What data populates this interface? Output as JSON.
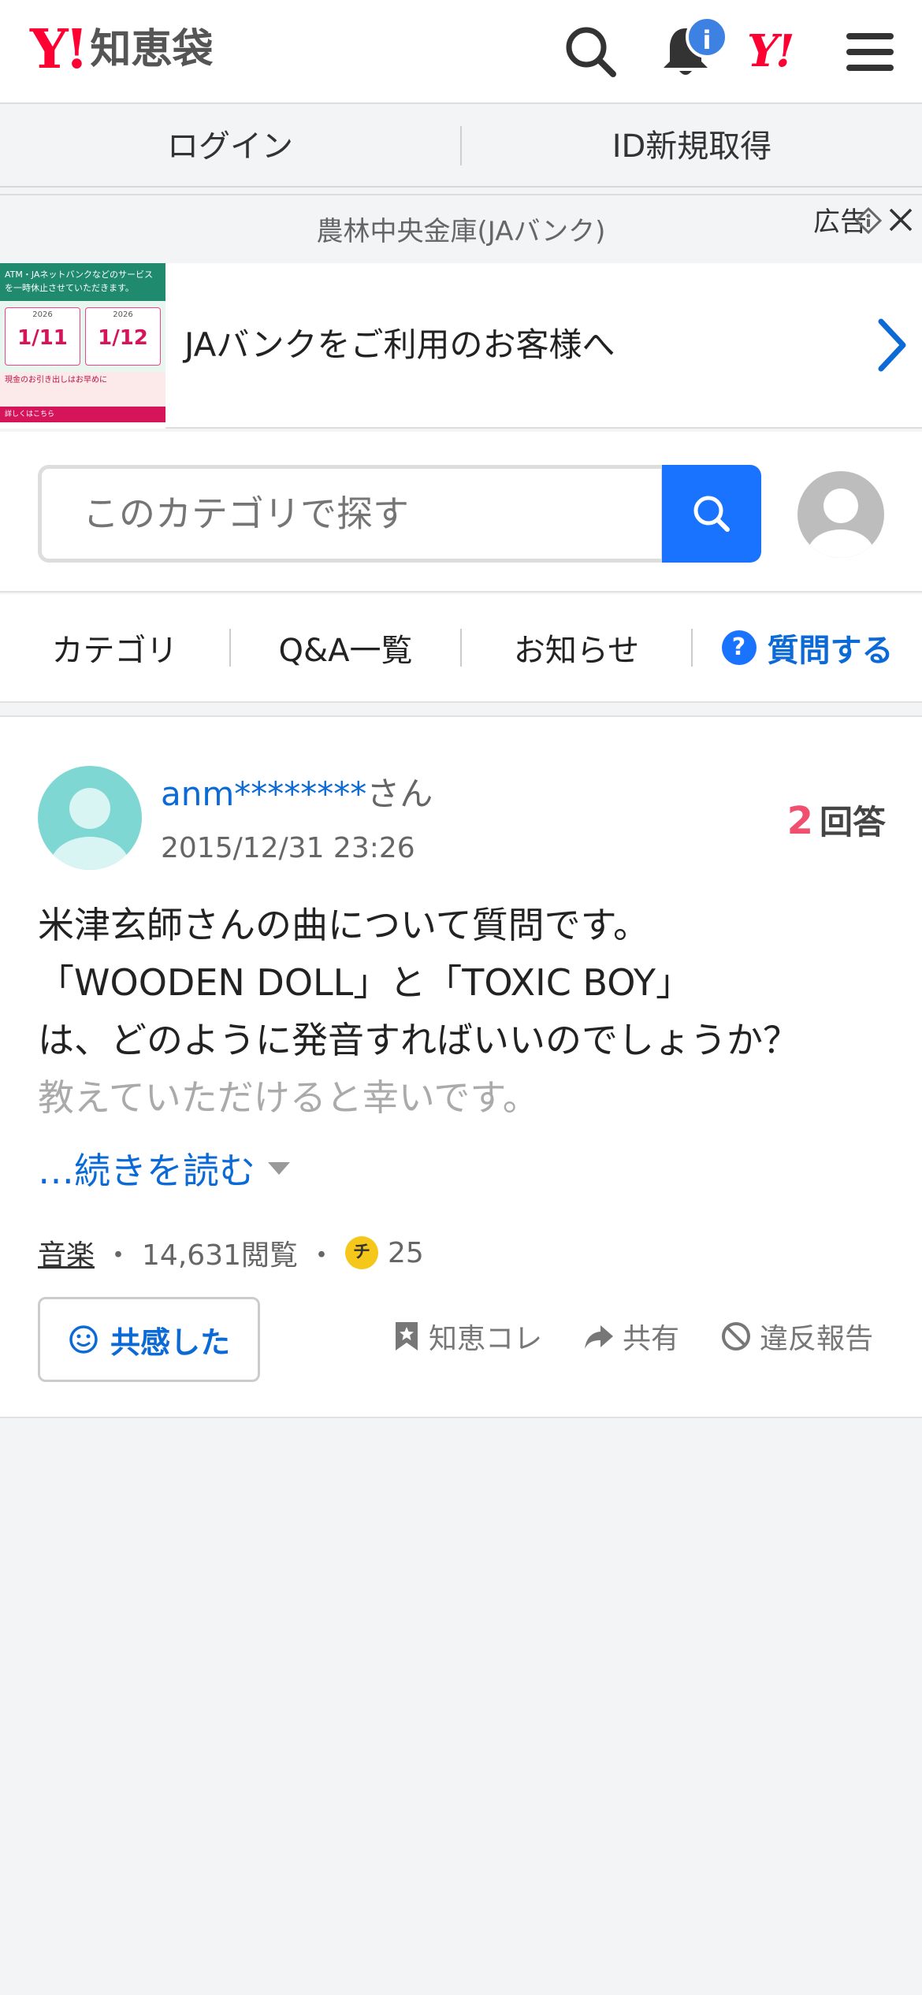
{
  "header": {
    "logo_mark": "Y!",
    "logo_text": "知恵袋",
    "notification_count": "i",
    "yj_mark": "Y!"
  },
  "loginbar": {
    "login": "ログイン",
    "register": "ID新規取得"
  },
  "ad": {
    "sponsor": "農林中央金庫(JAバンク)",
    "label": "広告",
    "title": "JAバンクをご利用のお客様へ",
    "image": {
      "top_text": "ATM・JAネットバンクなどのサービスを一時休止させていただきます。",
      "year1": "2026",
      "date1": "1/11",
      "year2": "2026",
      "date2": "1/12",
      "bottom_text": "現金のお引き出しはお早めに",
      "strip_text": "詳しくはこちら"
    }
  },
  "search": {
    "placeholder": "このカテゴリで探す"
  },
  "tabs": {
    "category": "カテゴリ",
    "qa_list": "Q&A一覧",
    "news": "お知らせ",
    "ask": "質問する",
    "ask_icon": "?"
  },
  "question": {
    "user": "anm********",
    "user_suffix": "さん",
    "date": "2015/12/31 23:26",
    "answer_count": "2",
    "answer_label": "回答",
    "lines": [
      "米津玄師さんの曲について質問です。",
      "「WOODEN DOLL」と「TOXIC BOY」",
      "は、どのように発音すればいいのでしょうか？",
      "教えていただけると幸いです。"
    ],
    "read_more": "…続きを読む",
    "category": "音楽",
    "views": "14,631閲覧",
    "coin_label": "チ",
    "coins": "25",
    "empathy_button": "共感した",
    "bookmark": "知恵コレ",
    "share": "共有",
    "report": "違反報告"
  },
  "colors": {
    "brand_red": "#ff0033",
    "link_blue": "#0b6ad6",
    "search_blue": "#1a73ff",
    "answer_count_red": "#f0506e"
  }
}
